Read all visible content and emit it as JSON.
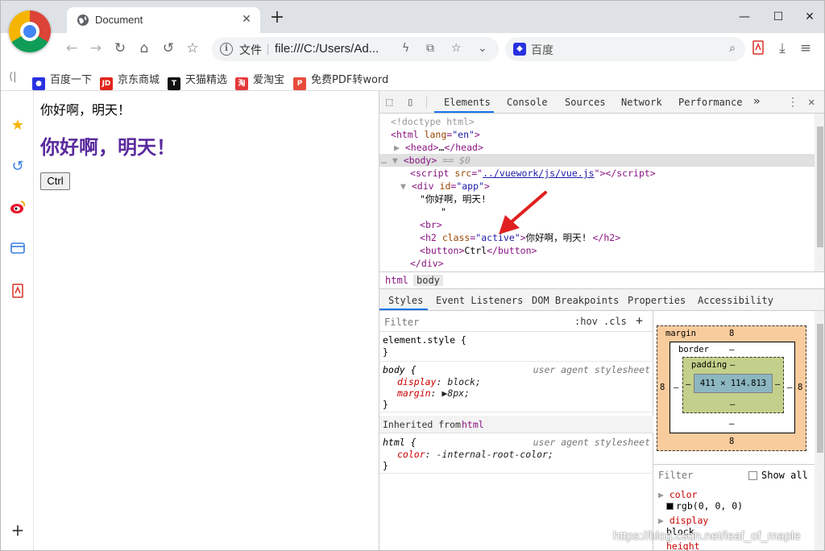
{
  "browser": {
    "tab_title": "Document",
    "tab_close": "✕",
    "new_tab": "+",
    "window_controls": [
      "—",
      "☐",
      "✕"
    ]
  },
  "toolbar": {
    "url_label": "文件",
    "url": "file:///C:/Users/Ad...",
    "search_placeholder": "百度"
  },
  "bookmarks": [
    {
      "label": "百度一下",
      "color": "#2932e1",
      "glyph": "🐾"
    },
    {
      "label": "京东商城",
      "color": "#e1251b",
      "glyph": "JD"
    },
    {
      "label": "天猫精选",
      "color": "#111111",
      "glyph": "T"
    },
    {
      "label": "爱淘宝",
      "color": "#e4393c",
      "glyph": "淘"
    },
    {
      "label": "免费PDF转word",
      "color": "#e74c3c",
      "glyph": "P"
    }
  ],
  "page": {
    "text": "你好啊，明天！",
    "heading": "你好啊，明天！",
    "button_label": "Ctrl"
  },
  "devtools": {
    "tabs": [
      "Elements",
      "Console",
      "Sources",
      "Network",
      "Performance"
    ],
    "more": "»",
    "dom": {
      "doctype": "<!doctype html>",
      "html_open": "html",
      "html_attr": "lang",
      "html_val": "\"en\"",
      "head": "head",
      "head_ellipsis": "…",
      "body": "body",
      "body_marker": " == $0",
      "script_tag": "script",
      "script_attr": "src",
      "script_src": "../vuework/js/vue.js",
      "div_tag": "div",
      "div_attr": "id",
      "div_val": "\"app\"",
      "text_node_1": "\"你好啊，明天!",
      "text_node_2": "\"",
      "br": "br",
      "h2_tag": "h2",
      "h2_attr": "class",
      "h2_val": "\"active\"",
      "h2_text": "你好啊，明天! ",
      "button_tag": "button",
      "button_text": "Ctrl",
      "div_close": "div"
    },
    "breadcrumbs": [
      "html",
      "body"
    ],
    "sub_tabs": [
      "Styles",
      "Event Listeners",
      "DOM Breakpoints",
      "Properties",
      "Accessibility"
    ],
    "styles": {
      "filter_placeholder": "Filter",
      "hov": ":hov",
      "cls": ".cls",
      "add": "+",
      "element_style": "element.style {",
      "close_brace": "}",
      "body_selector": "body {",
      "ua_source": "user agent stylesheet",
      "display_name": "display",
      "display_val": "block;",
      "margin_name": "margin",
      "margin_val": "8px;",
      "inherited_label": "Inherited from",
      "inherited_tag": "html",
      "html_selector": "html {",
      "color_name": "color",
      "color_val": "-internal-root-color;"
    },
    "box_model": {
      "margin_label": "margin",
      "margin_top": "8",
      "margin_bottom": "8",
      "margin_left": "8",
      "margin_right": "8",
      "border_label": "border",
      "border_value": "–",
      "padding_label": "padding",
      "padding_value": "–",
      "content": "411 × 114.813"
    },
    "computed": {
      "filter_placeholder": "Filter",
      "show_all": "Show all",
      "color_name": "color",
      "color_val": "rgb(0, 0, 0)",
      "display_name": "display",
      "display_val": "block",
      "height_name": "height"
    }
  },
  "watermark": "https://blog.csdn.net/leaf_of_maple",
  "colors": {
    "accent": "#1a73e8",
    "heading": "#5a2a9e",
    "arrow": "#e02020"
  }
}
